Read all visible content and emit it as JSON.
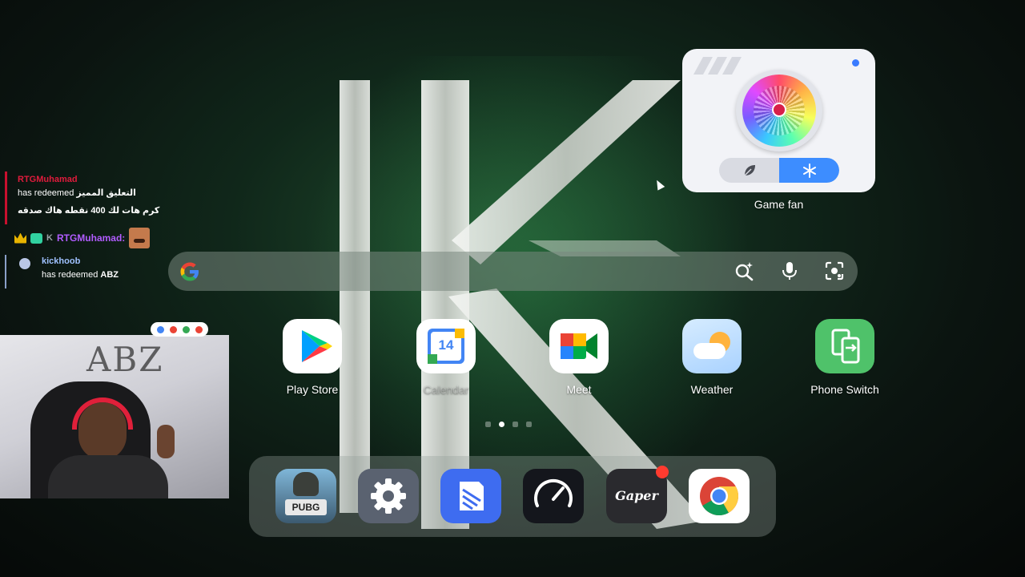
{
  "chat": {
    "messages": [
      {
        "user": "RTGMuhamad",
        "line1_prefix": "has redeemed ",
        "line1_reward": "التعليق المميز",
        "line2": "كرم هات لك 400 نقطه هاك صدقه"
      },
      {
        "user_initial": "K",
        "user": "RTGMuhamad:"
      },
      {
        "user": "kickhoob",
        "line1_prefix": "has redeemed ",
        "line1_reward": "ABZ"
      }
    ]
  },
  "webcam": {
    "wall_text": "ABZ"
  },
  "widget": {
    "label": "Game fan",
    "modes": [
      {
        "icon": "leaf-icon",
        "active": false
      },
      {
        "icon": "snowflake-icon",
        "active": true
      }
    ]
  },
  "apps": [
    {
      "label": "Play Store"
    },
    {
      "label": "Calendar",
      "date": "14"
    },
    {
      "label": "Meet"
    },
    {
      "label": "Weather"
    },
    {
      "label": "Phone Switch"
    }
  ],
  "pager": {
    "count": 4,
    "active": 1
  },
  "dock": [
    {
      "name": "PUBG MOBILE",
      "badge_text": "PUBG"
    },
    {
      "name": "Settings"
    },
    {
      "name": "Files"
    },
    {
      "name": "Speedtest"
    },
    {
      "name": "Gaper",
      "badge_text": "Gaper",
      "has_notification": true
    },
    {
      "name": "Chrome"
    }
  ],
  "colors": {
    "accent": "#3d8dff",
    "chat_red": "#e01b3c",
    "chat_purple": "#b15cff",
    "notification": "#ff3b2f"
  }
}
